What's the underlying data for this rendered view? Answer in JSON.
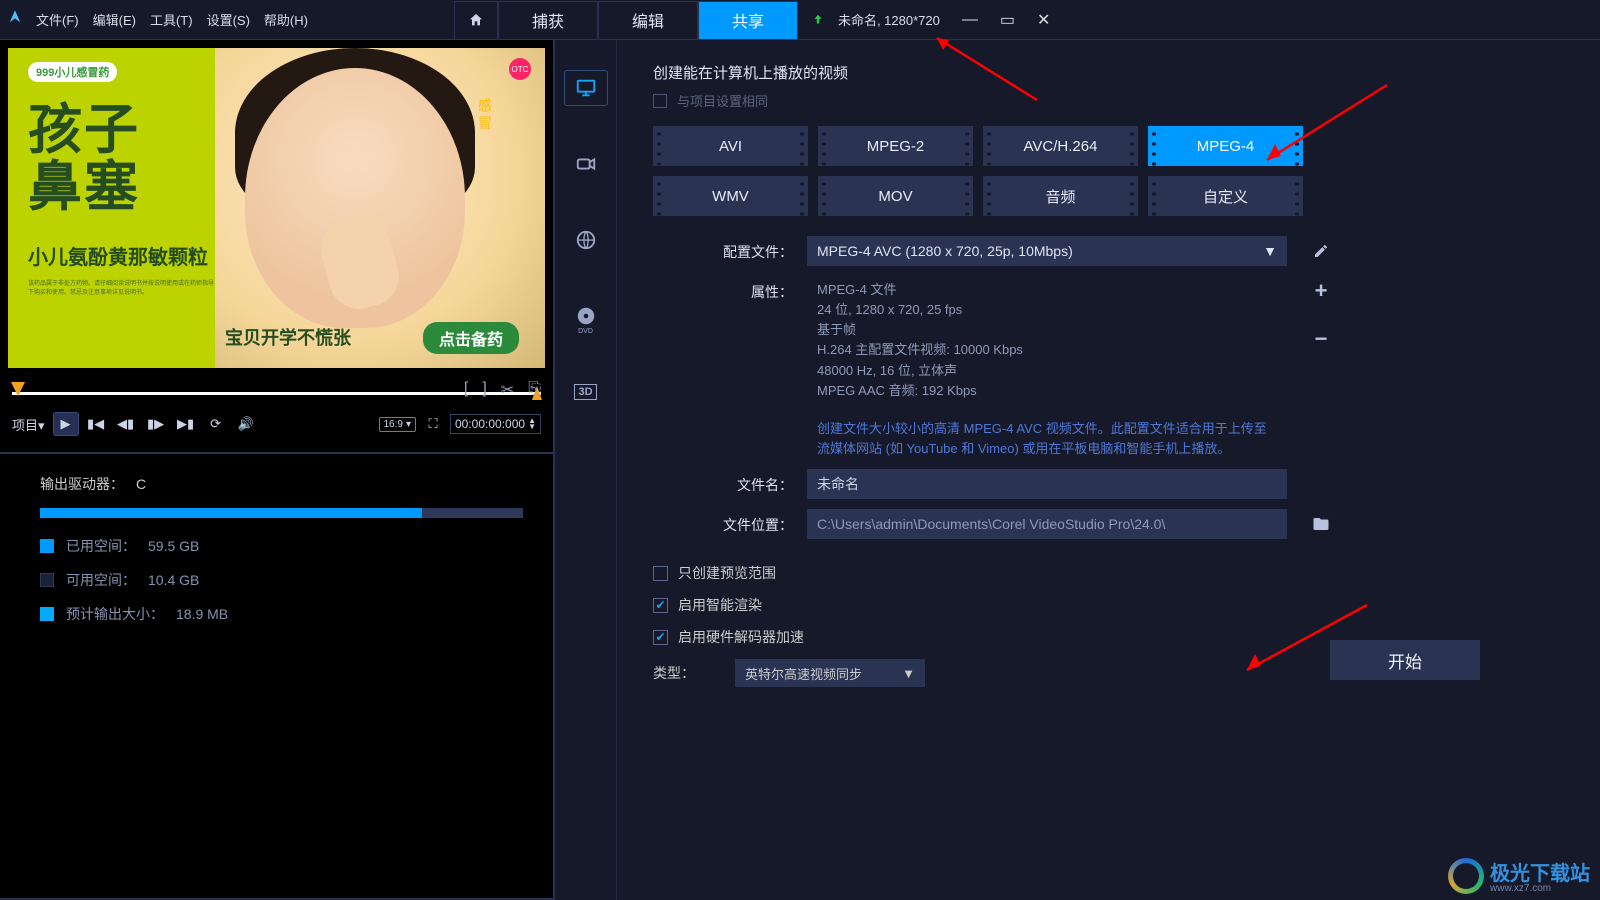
{
  "menu": {
    "file": "文件(F)",
    "edit": "编辑(E)",
    "tools": "工具(T)",
    "settings": "设置(S)",
    "help": "帮助(H)"
  },
  "tabs": {
    "capture": "捕获",
    "edit": "编辑",
    "share": "共享"
  },
  "project_label": "未命名, 1280*720",
  "preview": {
    "brand": "999小儿感冒药",
    "title_line1": "孩子",
    "title_line2": "鼻塞",
    "subtitle": "小儿氨酚黄那敏颗粒",
    "fineprint": "该药品属于非处方药物。请仔细阅读说明书并按说明使用或在药师指导下购买和使用。禁忌及注意事项详见说明书。",
    "tagline": "宝贝开学不慌张",
    "cta": "点击备药",
    "otc": "OTC",
    "capsule": "感 冒"
  },
  "player": {
    "label": "项目",
    "aspect": "16:9",
    "timecode": "00:00:00:000"
  },
  "drive": {
    "label": "输出驱动器：",
    "letter": "C",
    "used_label": "已用空间：",
    "used_value": "59.5 GB",
    "free_label": "可用空间：",
    "free_value": "10.4 GB",
    "est_label": "预计输出大小：",
    "est_value": "18.9 MB"
  },
  "share": {
    "heading": "创建能在计算机上播放的视频",
    "same_as_project": "与项目设置相同",
    "formats": {
      "avi": "AVI",
      "mpeg2": "MPEG-2",
      "avc": "AVC/H.264",
      "mpeg4": "MPEG-4",
      "wmv": "WMV",
      "mov": "MOV",
      "audio": "音频",
      "custom": "自定义"
    },
    "profile_label": "配置文件：",
    "profile_value": "MPEG-4 AVC (1280 x 720, 25p, 10Mbps)",
    "props_label": "属性：",
    "props": {
      "l1": "MPEG-4 文件",
      "l2": "24 位, 1280 x 720, 25 fps",
      "l3": "基于帧",
      "l4": "H.264 主配置文件视频: 10000 Kbps",
      "l5": "48000 Hz, 16 位, 立体声",
      "l6": "MPEG AAC 音频: 192 Kbps"
    },
    "desc": "创建文件大小较小的高清 MPEG-4 AVC 视频文件。此配置文件适合用于上传至流媒体网站 (如 YouTube 和 Vimeo) 或用在平板电脑和智能手机上播放。",
    "filename_label": "文件名：",
    "filename_value": "未命名",
    "filepath_label": "文件位置：",
    "filepath_value": "C:\\Users\\admin\\Documents\\Corel VideoStudio Pro\\24.0\\",
    "opt_preview_only": "只创建预览范围",
    "opt_smart_render": "启用智能渲染",
    "opt_hw_decode": "启用硬件解码器加速",
    "type_label": "类型：",
    "type_value": "英特尔高速视频同步",
    "start": "开始"
  },
  "watermark": {
    "name": "极光下载站",
    "url": "www.xz7.com"
  }
}
